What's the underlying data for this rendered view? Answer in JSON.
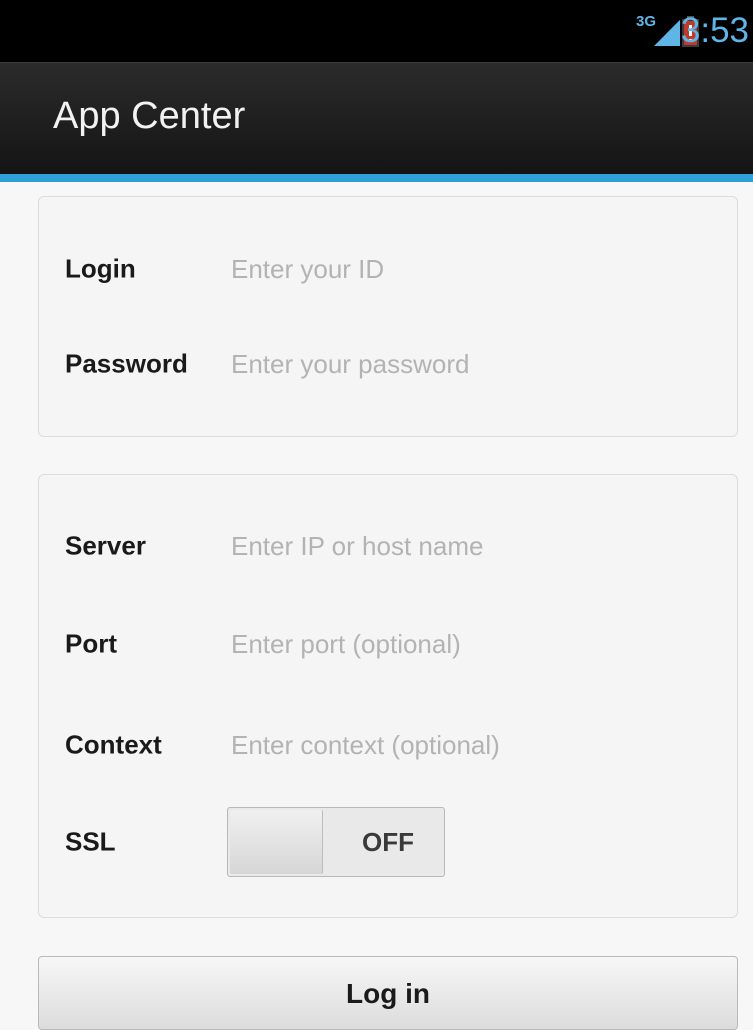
{
  "status_bar": {
    "network": "3G",
    "time": "3:53",
    "icons": [
      "signal-icon",
      "battery-icon"
    ],
    "battery_color": "#c0392b",
    "accent_color": "#5fb6e6"
  },
  "action_bar": {
    "title": "App Center",
    "accent_color": "#2f9fd8"
  },
  "credentials": {
    "login_label": "Login",
    "login_placeholder": "Enter your ID",
    "login_value": "",
    "password_label": "Password",
    "password_placeholder": "Enter your password",
    "password_value": ""
  },
  "server_settings": {
    "server_label": "Server",
    "server_placeholder": "Enter IP or host name",
    "server_value": "",
    "port_label": "Port",
    "port_placeholder": "Enter port (optional)",
    "port_value": "",
    "context_label": "Context",
    "context_placeholder": "Enter context (optional)",
    "context_value": "",
    "ssl_label": "SSL",
    "ssl_state": "OFF"
  },
  "actions": {
    "login_button": "Log in"
  }
}
